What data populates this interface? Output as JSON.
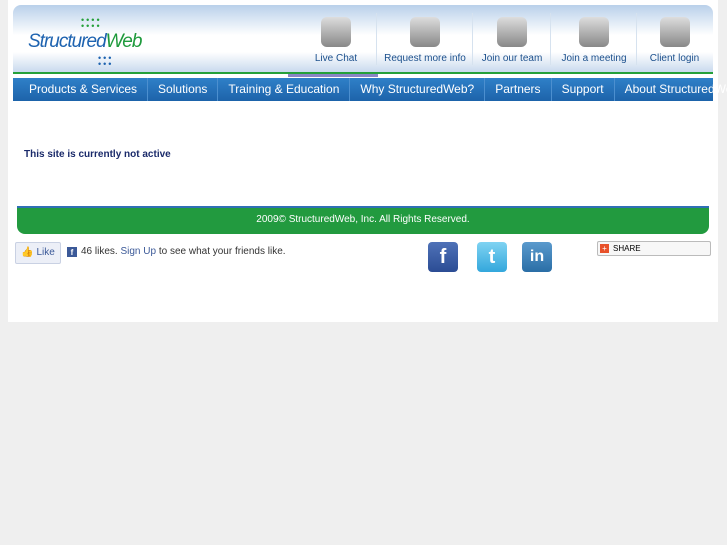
{
  "logo": {
    "text_a": "Structured",
    "text_b": "Web"
  },
  "toplinks": [
    {
      "label": "Live Chat",
      "icon": "live-chat-icon"
    },
    {
      "label": "Request more info",
      "icon": "folder-icon"
    },
    {
      "label": "Join our team",
      "icon": "team-icon"
    },
    {
      "label": "Join a meeting",
      "icon": "meeting-icon"
    },
    {
      "label": "Client login",
      "icon": "user-icon"
    }
  ],
  "nav": [
    "Products & Services",
    "Solutions",
    "Training & Education",
    "Why StructuredWeb?",
    "Partners",
    "Support",
    "About StructuredWeb"
  ],
  "main": {
    "message": "This site is currently not active"
  },
  "footer": {
    "copyright": "2009© StructuredWeb, Inc. All Rights Reserved."
  },
  "social": {
    "like_label": "Like",
    "likes_text": "46 likes.",
    "signup": "Sign Up",
    "suffix": " to see what your friends like.",
    "share_label": "SHARE"
  },
  "colors": {
    "nav": "#1d63aa",
    "footer": "#229a3f",
    "accent_line": "#25a03a"
  }
}
